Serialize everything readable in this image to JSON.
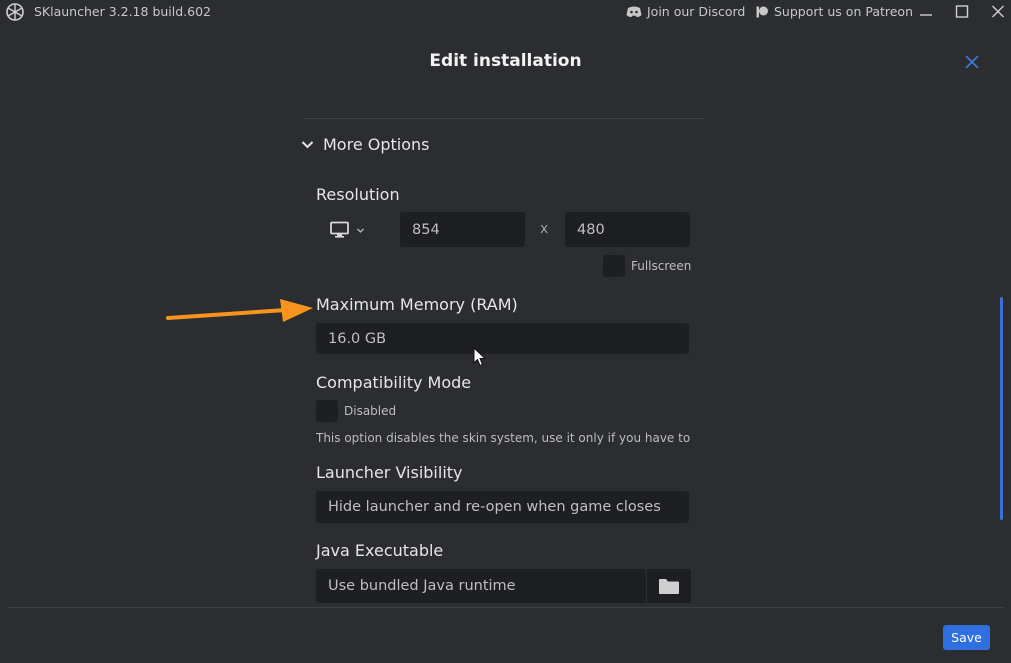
{
  "titlebar": {
    "app_title": "SKlauncher 3.2.18 build.602",
    "discord_label": "Join our Discord",
    "patreon_label": "Support us on Patreon",
    "icons": [
      "app-logo-icon",
      "discord-icon",
      "patreon-icon",
      "minimize-icon",
      "maximize-icon",
      "close-icon"
    ]
  },
  "dialog": {
    "title": "Edit installation",
    "more_options_label": "More Options"
  },
  "resolution": {
    "label": "Resolution",
    "width": "854",
    "separator": "x",
    "height": "480",
    "fullscreen_label": "Fullscreen"
  },
  "memory": {
    "label": "Maximum Memory (RAM)",
    "value": "16.0 GB"
  },
  "compatibility": {
    "label": "Compatibility Mode",
    "state_label": "Disabled",
    "hint": "This option disables the skin system, use it only if you have to"
  },
  "visibility": {
    "label": "Launcher Visibility",
    "value": "Hide launcher and re-open when game closes"
  },
  "java": {
    "label": "Java Executable",
    "value": "Use bundled Java runtime"
  },
  "footer": {
    "save_label": "Save"
  },
  "colors": {
    "background": "#2b2d30",
    "field": "#1e1f22",
    "accent": "#2f6fe0",
    "annotation_arrow": "#f7941d"
  }
}
